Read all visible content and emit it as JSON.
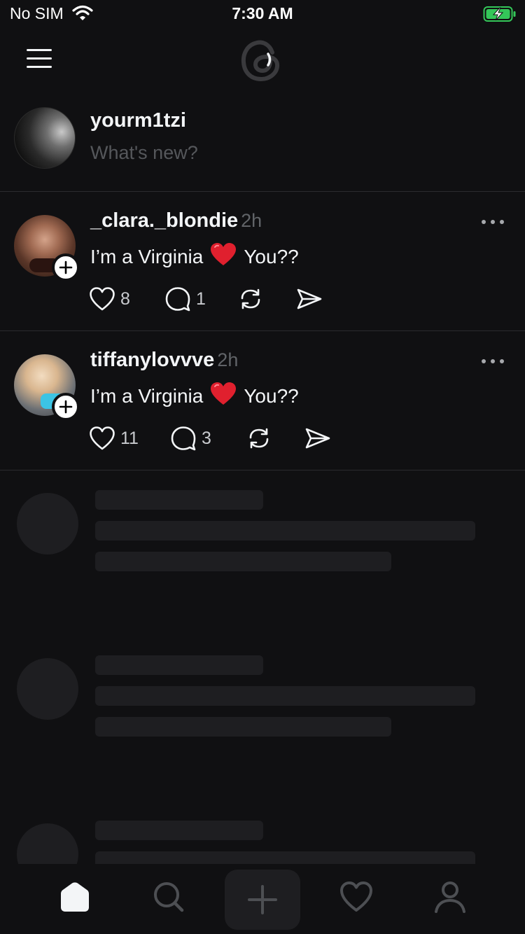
{
  "status_bar": {
    "carrier": "No SIM",
    "time": "7:30 AM",
    "battery_state": "charging",
    "battery_color": "#34c759"
  },
  "header": {
    "menu_icon": "hamburger-menu-icon",
    "logo": "threads-logo"
  },
  "composer": {
    "username": "yourm1tzi",
    "placeholder": "What's new?"
  },
  "posts": [
    {
      "username": "_clara._blondie",
      "time": "2h",
      "text_before": "I’m a Virginia",
      "emoji": "❤️",
      "text_after": "You??",
      "likes": "8",
      "replies": "1"
    },
    {
      "username": "tiffanylovvve",
      "time": "2h",
      "text_before": "I’m a Virginia",
      "emoji": "❤️",
      "text_after": "You??",
      "likes": "11",
      "replies": "3"
    }
  ],
  "tabs": [
    {
      "name": "home",
      "icon": "home-icon",
      "active": true
    },
    {
      "name": "search",
      "icon": "search-icon",
      "active": false
    },
    {
      "name": "create",
      "icon": "plus-icon",
      "active": false
    },
    {
      "name": "activity",
      "icon": "heart-icon",
      "active": false
    },
    {
      "name": "profile",
      "icon": "person-icon",
      "active": false
    }
  ],
  "colors": {
    "background": "#101012",
    "text_primary": "#f3f5f7",
    "text_secondary": "#616468",
    "skeleton": "#1e1e21"
  }
}
